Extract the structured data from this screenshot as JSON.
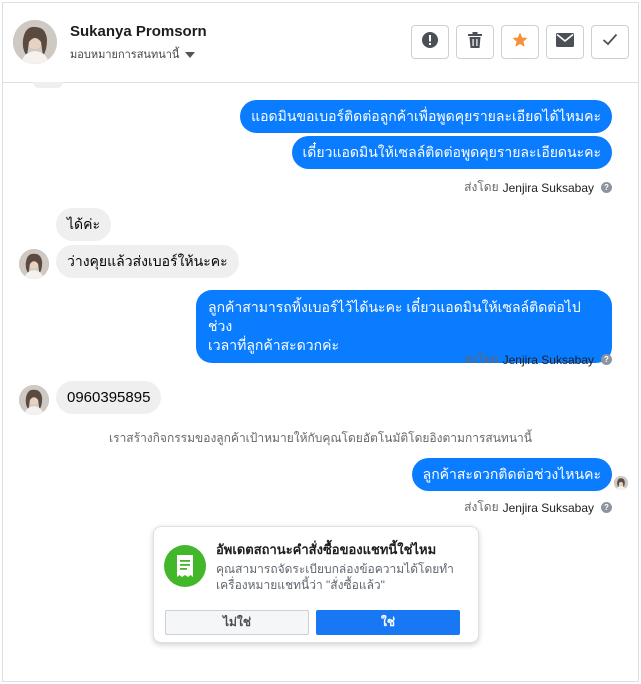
{
  "header": {
    "contact_name": "Sukanya Promsorn",
    "assign_label": "มอบหมายการสนทนานี้",
    "tools": [
      {
        "icon": "alert-icon"
      },
      {
        "icon": "trash-icon"
      },
      {
        "icon": "star-icon",
        "color": "#f7923a"
      },
      {
        "icon": "mail-icon"
      },
      {
        "icon": "check-icon"
      }
    ]
  },
  "messages": {
    "out_1": "แอดมินขอเบอร์ติดต่อลูกค้าเพื่อพูดคุยรายละเอียดได้ไหมคะ",
    "out_2": "เดี๋ยวแอดมินให้เซลล์ติดต่อพูดคุยรายละเอียดนะคะ",
    "sent_by_1": "ส่งโดย",
    "sender_1": "Jenjira Suksabay",
    "in_1": "ได้ค่ะ",
    "in_2": "ว่างคุยแล้วส่งเบอร์ให้นะคะ",
    "out_3_line1": "ลูกค้าสามารถทิ้งเบอร์ไว้ได้นะคะ เดี๋ยวแอดมินให้เซลล์ติดต่อไปช่วง",
    "out_3_line2": "เวลาที่ลูกค้าสะดวกค่ะ",
    "sent_by_2": "ส่งโดย",
    "sender_2": "Jenjira Suksabay",
    "in_3": "0960395895",
    "system_note": "เราสร้างกิจกรรมของลูกค้าเป้าหมายให้กับคุณโดยอัตโนมัติโดยอิงตามการสนทนานี้",
    "out_4": "ลูกค้าสะดวกติดต่อช่วงไหนคะ",
    "sent_by_3": "ส่งโดย",
    "sender_3": "Jenjira Suksabay"
  },
  "card": {
    "title": "อัพเดตสถานะคำสั่งซื้อของแชทนี้ใช่ไหม",
    "description": "คุณสามารถจัดระเบียบกล่องข้อความได้โดยทำเครื่องหมายแชทนี้ว่า \"สั่งซื้อแล้ว\"",
    "no_label": "ไม่ใช่",
    "yes_label": "ใช่",
    "icon": "receipt-icon"
  },
  "colors": {
    "outgoing_bubble": "#0a7cff",
    "incoming_bubble": "#efefef",
    "primary_button": "#1877f2",
    "card_icon_bg": "#42b72a"
  }
}
